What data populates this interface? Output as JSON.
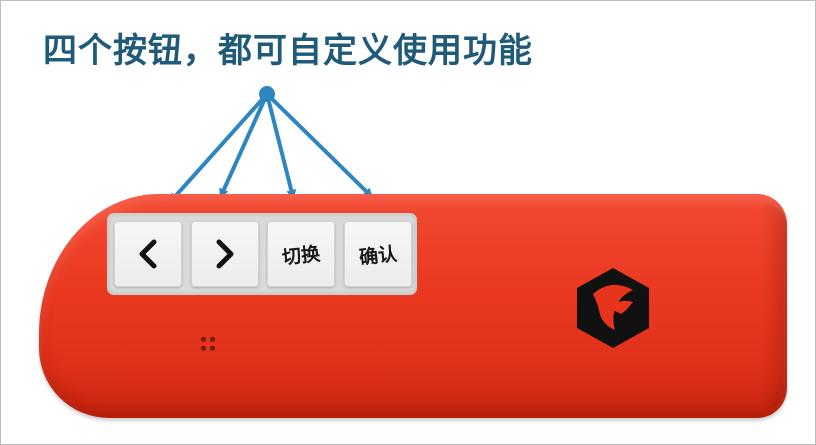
{
  "caption": {
    "text": "四个按钮，都可自定义使用功能"
  },
  "buttons": [
    {
      "label": "",
      "icon": "chevron-left-icon"
    },
    {
      "label": "",
      "icon": "chevron-right-icon"
    },
    {
      "label": "切换",
      "icon": ""
    },
    {
      "label": "确认",
      "icon": ""
    }
  ],
  "colors": {
    "caption": "#1f5a78",
    "arrow": "#2e86c1",
    "device_body": "#ec3a22",
    "key_face": "#f2f2f2",
    "logo": "#111111"
  }
}
